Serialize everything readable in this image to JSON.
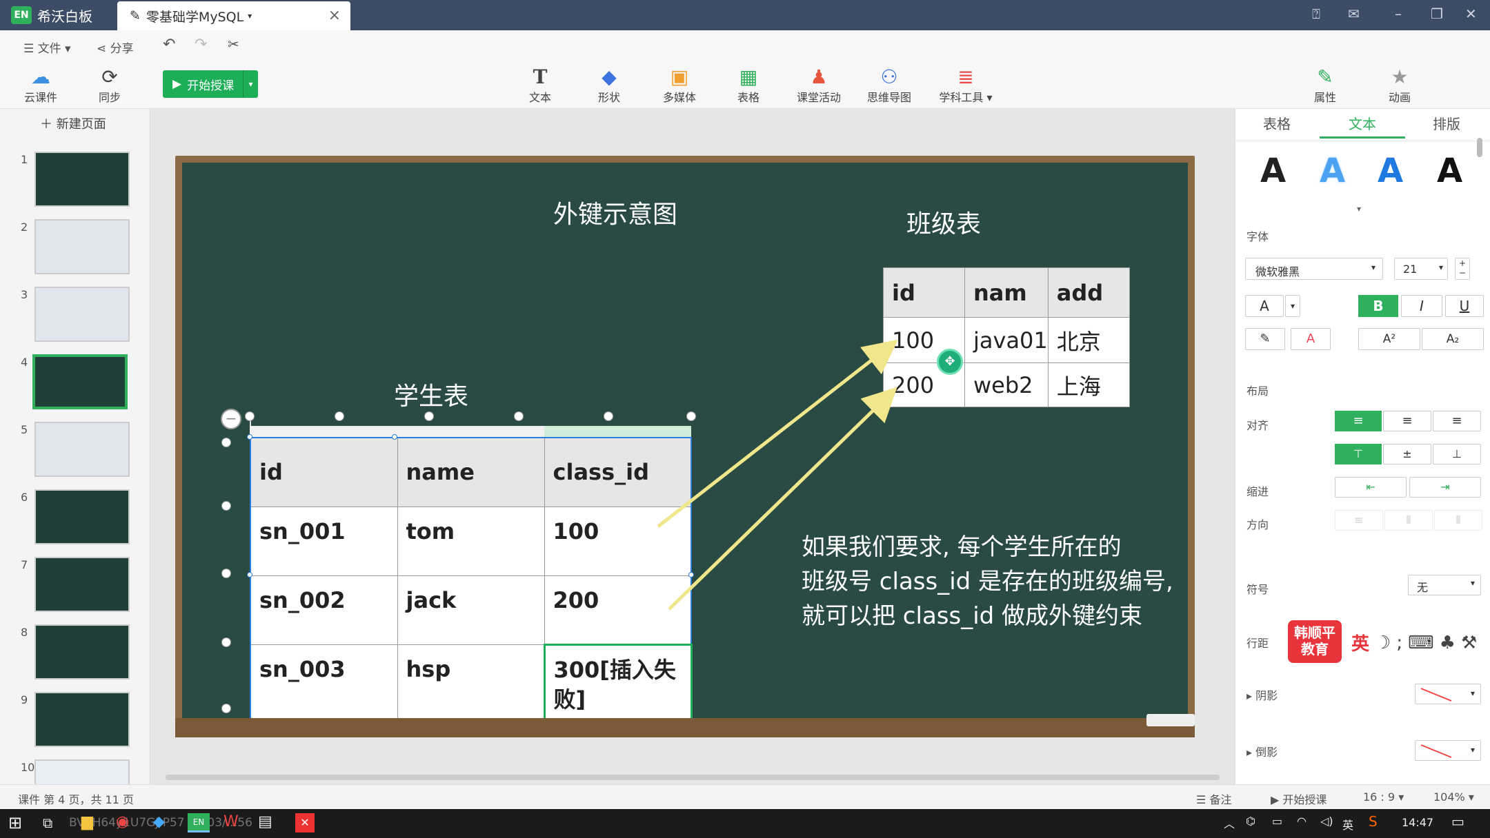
{
  "app": {
    "title": "希沃白板",
    "logo": "EN",
    "doc_tab": "零基础学MySQL"
  },
  "menu": {
    "file": "文件",
    "share": "分享"
  },
  "toolbar": {
    "cloud": "云课件",
    "sync": "同步",
    "start": "开始授课",
    "text": "文本",
    "shape": "形状",
    "media": "多媒体",
    "table": "表格",
    "activity": "课堂活动",
    "mindmap": "思维导图",
    "subject": "学科工具",
    "props": "属性",
    "anim": "动画"
  },
  "sidebar": {
    "new_page": "新建页面",
    "pages": [
      "1",
      "2",
      "3",
      "4",
      "5",
      "6",
      "7",
      "8",
      "9",
      "10"
    ],
    "active": 4
  },
  "slide": {
    "diagram_title": "外键示意图",
    "class_title": "班级表",
    "student_title": "学生表",
    "class_headers": [
      "id",
      "nam",
      "add"
    ],
    "class_rows": [
      [
        "100",
        "java01",
        "北京"
      ],
      [
        "200",
        "web2",
        "上海"
      ]
    ],
    "student_headers": [
      "id",
      "name",
      "class_id"
    ],
    "student_rows": [
      [
        "sn_001",
        "tom",
        "100"
      ],
      [
        "sn_002",
        "jack",
        "200"
      ],
      [
        "sn_003",
        "hsp",
        "300[插入失败]"
      ]
    ],
    "note_line1": "如果我们要求, 每个学生所在的",
    "note_line2": "班级号 class_id 是存在的班级编号,",
    "note_line3": "就可以把 class_id 做成外键约束"
  },
  "props_panel": {
    "tabs": [
      "表格",
      "文本",
      "排版"
    ],
    "font_label": "字体",
    "font": "微软雅黑",
    "size": "21",
    "layout": "布局",
    "align": "对齐",
    "indent": "缩进",
    "direction": "方向",
    "symbol": "符号",
    "symbol_value": "无",
    "line_spacing": "行距",
    "shadow": "阴影",
    "reflection": "倒影",
    "brand": "韩顺平教育",
    "ime": "英"
  },
  "status": {
    "page_info": "课件 第 4 页，共 11 页",
    "notes": "备注",
    "start": "开始授课",
    "ratio": "16 : 9",
    "zoom": "104%"
  },
  "taskbar": {
    "time": "14:47",
    "lang": "英",
    "watermark": "BV1H64y1U7GJ P57 08/03/..:56"
  }
}
